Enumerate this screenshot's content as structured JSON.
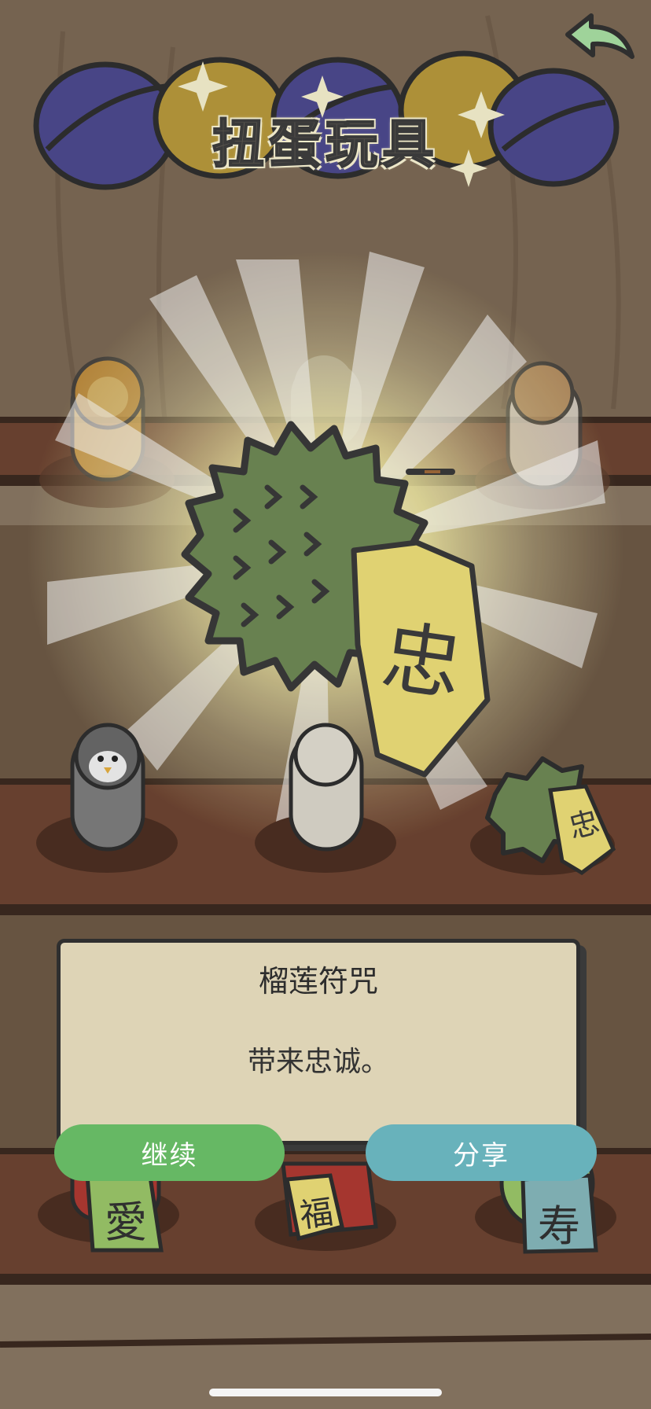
{
  "header": {
    "title": "扭蛋玩具",
    "back_icon": "back-arrow-icon"
  },
  "featured_item": {
    "name": "榴莲符咒",
    "description": "带来忠诚。",
    "tag_text": "忠"
  },
  "shelf_items": [
    {
      "name": "lion-figurine"
    },
    {
      "name": "polar-bear-figurine"
    },
    {
      "name": "dog-figurine"
    },
    {
      "name": "penguin-figurine"
    },
    {
      "name": "bear-figurine"
    },
    {
      "name": "durian-charm",
      "tag_text": "忠"
    },
    {
      "name": "love-charm",
      "tag_text": "愛"
    },
    {
      "name": "fortune-charm",
      "tag_text": "福"
    },
    {
      "name": "longevity-charm",
      "tag_text": "寿"
    }
  ],
  "actions": {
    "continue_label": "继续",
    "share_label": "分享"
  },
  "colors": {
    "wall": "#7d6a55",
    "shelf": "#6e4532",
    "card": "#ded4b6",
    "continue": "#66b864",
    "share": "#68b2bb",
    "tag_yellow": "#efe07a",
    "durian_green": "#6f8a55"
  }
}
